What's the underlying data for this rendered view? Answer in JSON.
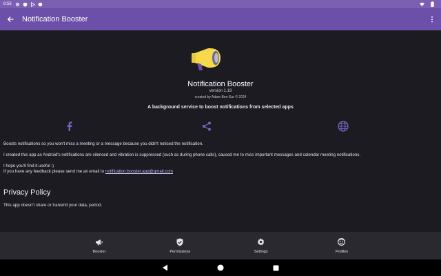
{
  "status_bar": {
    "time": "8:56"
  },
  "app_bar": {
    "title": "Notification Booster"
  },
  "about": {
    "app_name": "Notification Booster",
    "version": "version 1.19",
    "created_by": "created by Adam Ben-Sur © 2024",
    "tagline": "A background service to boost notifications from selected apps",
    "paragraph1": "Boosts notifications so you won't miss a meeting or a message because you didn't noticed the notification.",
    "paragraph2": "I created this app as Android's notifications are silenced and vibration is suppressed (such as during phone calls), caused me to miss important messages and calendar meeting notifications.",
    "paragraph3": "I hope you'll find it useful :)",
    "paragraph4_prefix": "If you have any feedback please send me an email to ",
    "email": "notification.booster.app@gmail.com"
  },
  "privacy": {
    "title": "Privacy Policy",
    "text": "This app doesn't share or transmit your data, period."
  },
  "bottom_nav": {
    "items": [
      {
        "label": "Booster",
        "icon": "megaphone-icon"
      },
      {
        "label": "Permissions",
        "icon": "shield-check-icon"
      },
      {
        "label": "Settings",
        "icon": "gear-icon"
      },
      {
        "label": "Profiles",
        "icon": "face-icon"
      }
    ]
  },
  "colors": {
    "app_bar": "#6b4fa8",
    "status_bar": "#7b5fb3",
    "background": "#1c1b21",
    "accent": "#9c7fe0",
    "logo_yellow": "#f5d94a"
  }
}
